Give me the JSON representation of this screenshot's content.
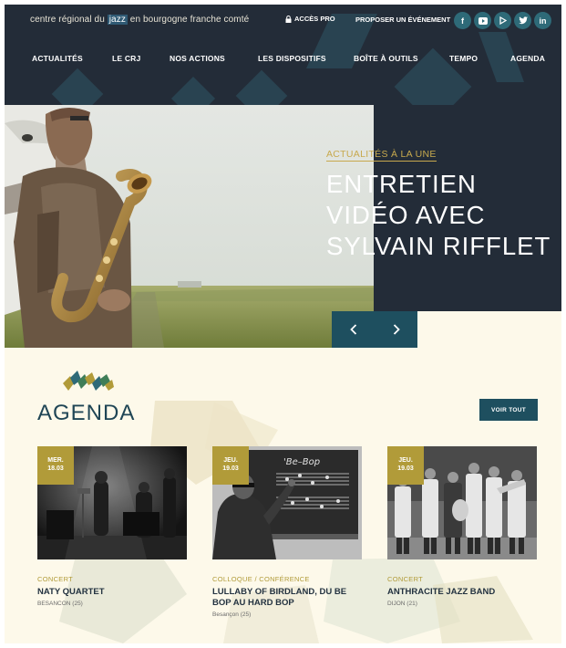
{
  "header": {
    "site_name_before": "centre régional du ",
    "site_name_highlight": "jazz",
    "site_name_after": " en bourgogne franche comté",
    "acces_pro": "ACCÈS PRO",
    "proposer": "PROPOSER UN ÉVÉNEMENT",
    "socials": [
      {
        "label": "f",
        "icon": "facebook-icon"
      },
      {
        "label": "▶",
        "icon": "youtube-icon"
      },
      {
        "label": "▷",
        "icon": "play-icon"
      },
      {
        "label": "🐦",
        "icon": "twitter-icon"
      },
      {
        "label": "in",
        "icon": "linkedin-icon"
      }
    ],
    "nav": [
      "ACTUALITÉS",
      "LE CRJ",
      "NOS ACTIONS",
      "LES DISPOSITIFS",
      "BOÎTE À OUTILS",
      "TEMPO",
      "AGENDA"
    ]
  },
  "hero": {
    "label": "ACTUALITÉS À LA UNE",
    "title": "ENTRETIEN VIDÉO AVEC SYLVAIN RIFFLET",
    "prev_label": "‹",
    "next_label": "›"
  },
  "agenda": {
    "title": "AGENDA",
    "voir_tout": "VOIR TOUT",
    "cards": [
      {
        "day": "MER.",
        "date": "18.03",
        "category": "CONCERT",
        "title": "NATY QUARTET",
        "location": "BESANCON (25)"
      },
      {
        "day": "JEU.",
        "date": "19.03",
        "category": "COLLOQUE / CONFÉRENCE",
        "title": "LULLABY OF BIRDLAND, DU BE BOP AU HARD BOP",
        "location": "Besançon (25)"
      },
      {
        "day": "JEU.",
        "date": "19.03",
        "category": "CONCERT",
        "title": "ANTHRACITE JAZZ BAND",
        "location": "DIJON (21)"
      }
    ]
  },
  "colors": {
    "navy": "#232c38",
    "teal": "#1e4f5f",
    "gold": "#b19b39",
    "cream": "#fdf9ea"
  }
}
